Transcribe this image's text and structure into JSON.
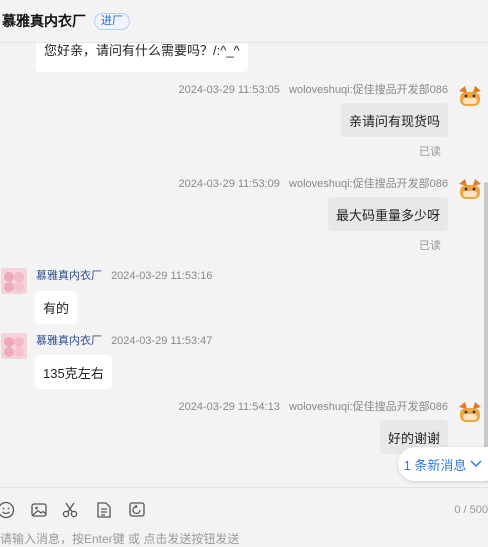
{
  "header": {
    "shop_name": "慕雅真内衣厂",
    "badge": "进厂"
  },
  "messages": [
    {
      "type": "agent_text",
      "text": "您好亲，请问有什么需要吗？/:^_^"
    },
    {
      "type": "user",
      "time": "2024-03-29 11:53:05",
      "sender": "woloveshuqi:促佳搜品开发部086",
      "text": "亲请问有现货吗",
      "status": "已读"
    },
    {
      "type": "user",
      "time": "2024-03-29 11:53:09",
      "sender": "woloveshuqi:促佳搜品开发部086",
      "text": "最大码重量多少呀",
      "status": "已读"
    },
    {
      "type": "agent",
      "sender": "慕雅真内衣厂",
      "time": "2024-03-29 11:53:16",
      "text": "有的"
    },
    {
      "type": "agent",
      "sender": "慕雅真内衣厂",
      "time": "2024-03-29 11:53:47",
      "text": "135克左右"
    },
    {
      "type": "user",
      "time": "2024-03-29 11:54:13",
      "sender": "woloveshuqi:促佳搜品开发部086",
      "text": "好的谢谢"
    }
  ],
  "new_messages": "1 条新消息",
  "toolbar": {
    "icons": [
      "emoji-icon",
      "image-icon",
      "scissors-icon",
      "document-icon",
      "history-icon"
    ]
  },
  "input": {
    "counter": "0 / 500",
    "placeholder": "请输入消息，按Enter键 或 点击发送按钮发送"
  }
}
